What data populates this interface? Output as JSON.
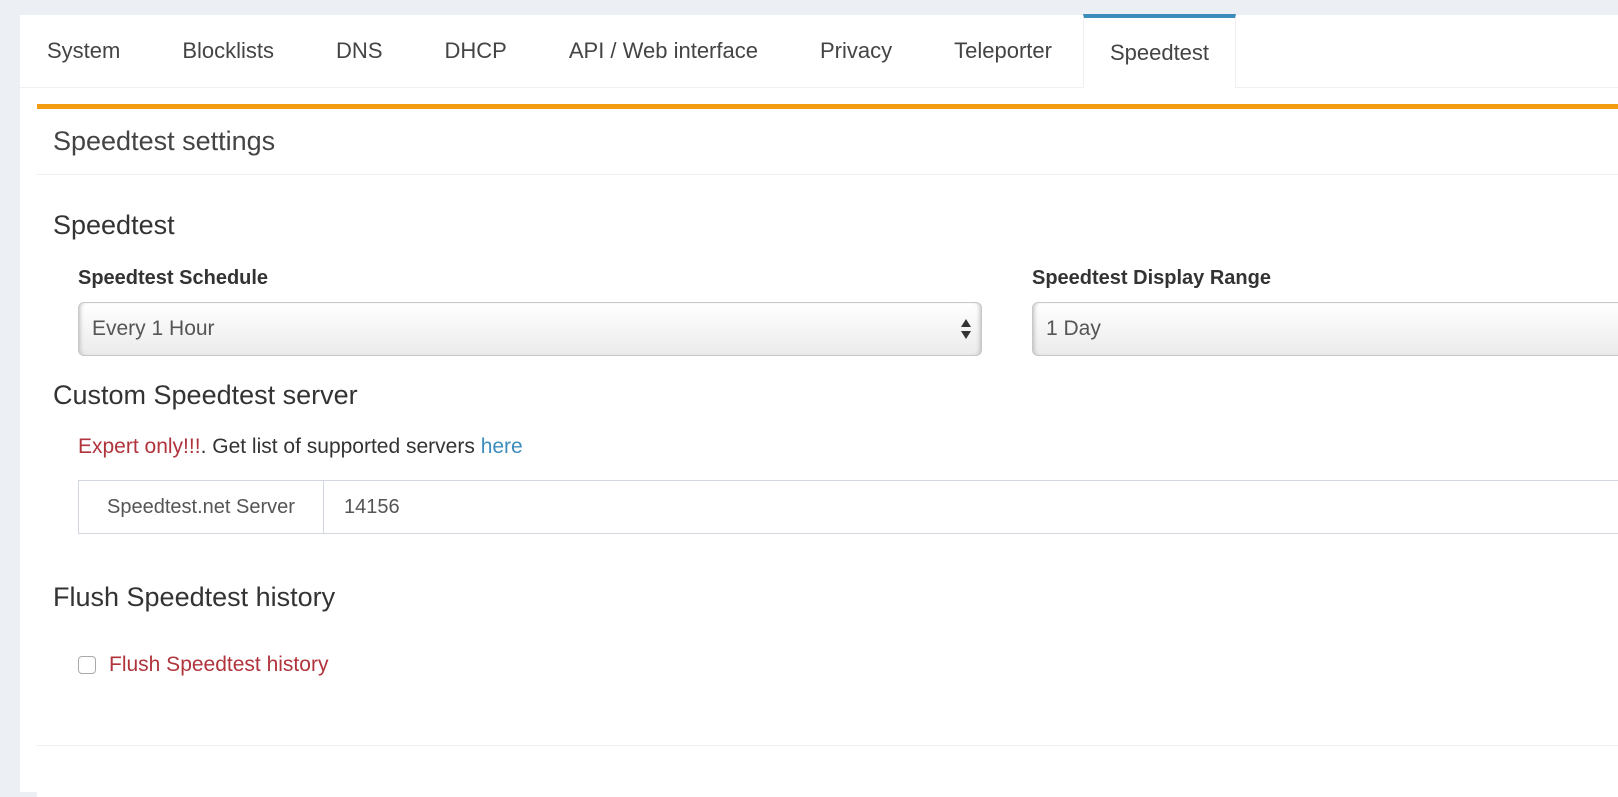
{
  "tabs": [
    {
      "label": "System"
    },
    {
      "label": "Blocklists"
    },
    {
      "label": "DNS"
    },
    {
      "label": "DHCP"
    },
    {
      "label": "API / Web interface"
    },
    {
      "label": "Privacy"
    },
    {
      "label": "Teleporter"
    },
    {
      "label": "Speedtest"
    }
  ],
  "active_tab": "Speedtest",
  "box": {
    "title": "Speedtest settings"
  },
  "speedtest_section": {
    "title": "Speedtest",
    "schedule": {
      "label": "Speedtest Schedule",
      "value": "Every 1 Hour"
    },
    "display_range": {
      "label": "Speedtest Display Range",
      "value": "1 Day"
    }
  },
  "custom_server": {
    "title": "Custom Speedtest server",
    "warning": "Expert only!!!",
    "note_text": ". Get list of supported servers ",
    "link_text": "here",
    "addon_label": "Speedtest.net Server",
    "server_value": "14156"
  },
  "flush": {
    "title": "Flush Speedtest history",
    "checkbox_label": "Flush Speedtest history",
    "checked": false
  },
  "colors": {
    "active_tab_border": "#3c8dbc",
    "box_top_border": "#f39c12",
    "danger_text": "#b0343c",
    "link": "#3c8dbc"
  }
}
